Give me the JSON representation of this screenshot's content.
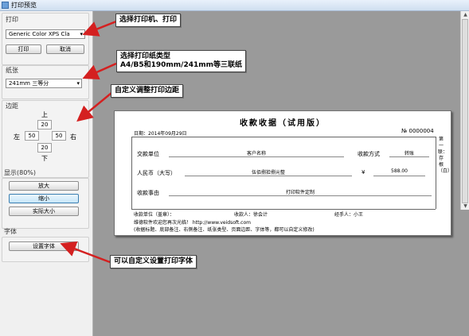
{
  "window": {
    "title": "打印预览"
  },
  "printer": {
    "group_label": "打印",
    "selected": "Generic Color XPS Cla",
    "print_button": "打印",
    "cancel_button": "取消"
  },
  "paper": {
    "group_label": "纸张",
    "selected": "241mm 三等分"
  },
  "margins": {
    "group_label": "边距",
    "top": "20",
    "left": "50",
    "right": "50",
    "bottom": "20",
    "top_label": "上",
    "left_label": "左",
    "right_label": "右",
    "bottom_label": "下"
  },
  "display": {
    "group_label": "显示(80%)",
    "zoom_in": "放大",
    "zoom_out": "缩小",
    "actual_size": "实际大小"
  },
  "font": {
    "group_label": "字体",
    "set_font_button": "设置字体"
  },
  "receipt": {
    "title": "收款收据（试用版）",
    "date": "日期：2014年09月29日",
    "number": "№ 0000004",
    "payer_label": "交款单位",
    "customer_name": "客户名称",
    "method_label": "收款方式",
    "method_value": "转账",
    "rmb_label": "人民币（大写）",
    "amount_words": "伍佰捌拾捌元整",
    "yen": "¥",
    "amount": "588.00",
    "reason_label": "收款事由",
    "reason_value": "打印软件定制",
    "footer_unit": "收款单位（盖章）：",
    "footer_accountant": "收款人：徐会计",
    "footer_handler": "经手人：小王",
    "note1": "维德软件欢迎您再次光临！ http://www.veidsoft.com",
    "note2": "(收据标题、底部备注、右侧备注、纸张类型、页面边距、字体等，都可以自定义修改)",
    "side_note": "第一联：存根（白）"
  },
  "callouts": {
    "printer": "选择打印机、打印",
    "paper_line1": "选择打印纸类型",
    "paper_line2": "A4/B5和190mm/241mm等三联纸",
    "margins": "自定义调整打印边距",
    "font": "可以自定义设置打印字体"
  },
  "colors": {
    "arrow": "#d42020",
    "callout_border": "#444444"
  }
}
